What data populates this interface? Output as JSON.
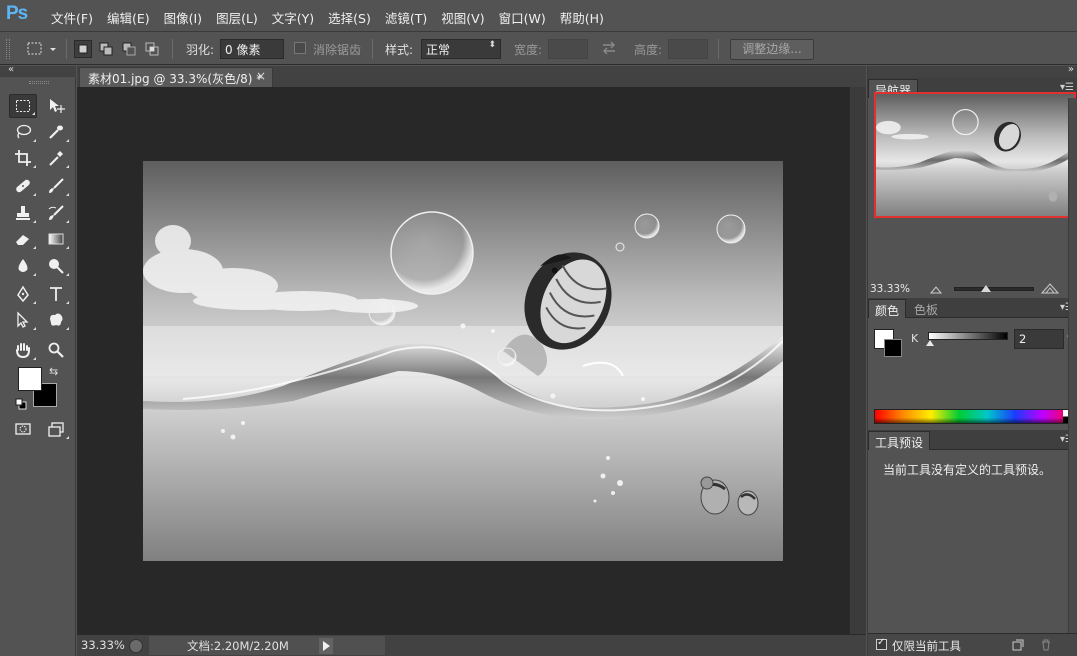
{
  "app": {
    "logo": "Ps"
  },
  "menu": [
    "文件(F)",
    "编辑(E)",
    "图像(I)",
    "图层(L)",
    "文字(Y)",
    "选择(S)",
    "滤镜(T)",
    "视图(V)",
    "窗口(W)",
    "帮助(H)"
  ],
  "options_bar": {
    "feather_label": "羽化:",
    "feather_value": "0 像素",
    "antialias_label": "消除锯齿",
    "style_label": "样式:",
    "style_value": "正常",
    "width_label": "宽度:",
    "height_label": "高度:",
    "refine_edge_button": "调整边缘..."
  },
  "document": {
    "tab_title": "素材01.jpg @ 33.3%(灰色/8) *",
    "tab_close": "×"
  },
  "status_bar": {
    "zoom": "33.33%",
    "doc_info": "文档:2.20M/2.20M"
  },
  "navigator": {
    "tab": "导航器",
    "zoom": "33.33%"
  },
  "color_panel": {
    "tabs": [
      "颜色",
      "色板"
    ],
    "channel_label": "K",
    "channel_value": "2",
    "channel_unit": "%",
    "foreground": "#ffffff",
    "background": "#000000"
  },
  "tool_presets": {
    "tab": "工具预设",
    "empty_message": "当前工具没有定义的工具预设。",
    "current_tool_only_label": "仅限当前工具"
  },
  "tools": [
    "rectangular-marquee",
    "move",
    "lasso",
    "quick-selection",
    "crop",
    "eyedropper",
    "spot-healing-brush",
    "brush",
    "clone-stamp",
    "history-brush",
    "eraser",
    "gradient",
    "blur",
    "dodge",
    "pen",
    "type",
    "path-selection",
    "custom-shape",
    "hand",
    "zoom"
  ],
  "colors": {
    "accent": "#5cb6f5",
    "nav_frame": "#e03030"
  }
}
